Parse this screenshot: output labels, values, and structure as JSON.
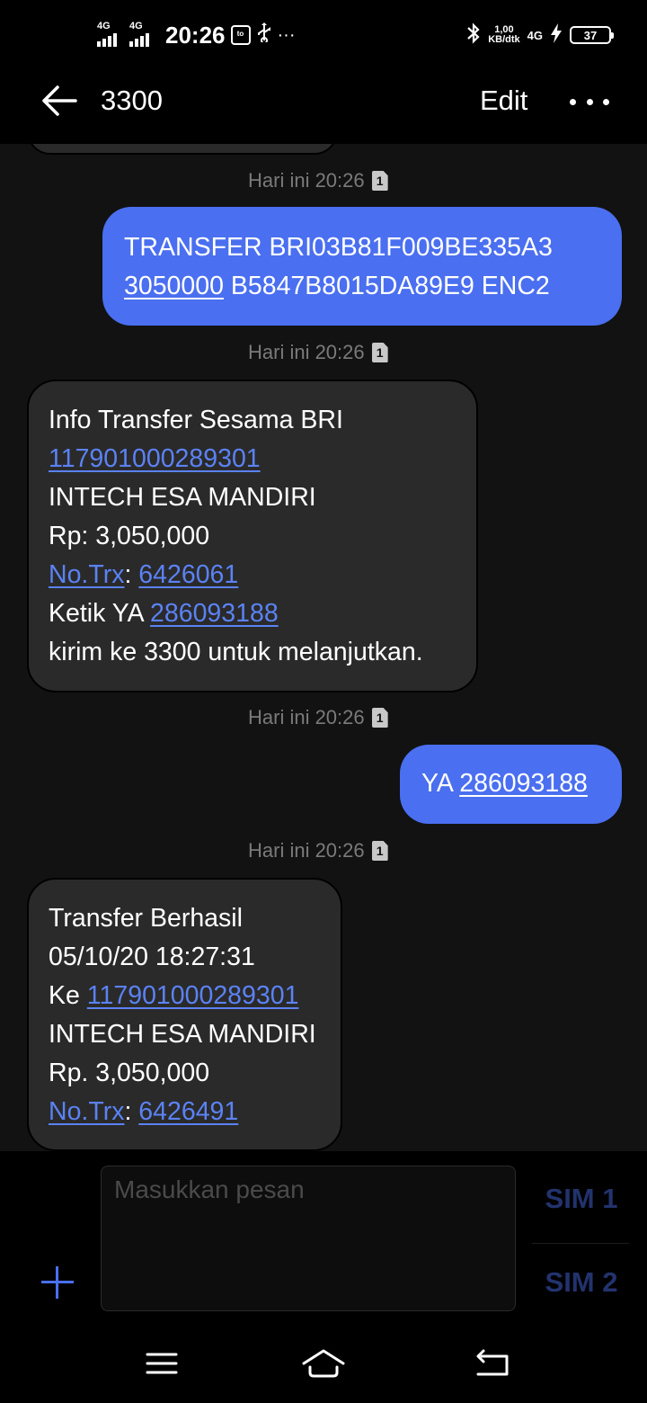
{
  "status_bar": {
    "network_1": "4G",
    "network_2": "4G",
    "time": "20:26",
    "app_badge": "ᵗᵒ",
    "more": "···",
    "speed_value": "1,00",
    "speed_unit": "KB/dtk",
    "network_type": "4G",
    "battery_level": "37"
  },
  "header": {
    "title": "3300",
    "edit_label": "Edit"
  },
  "messages": [
    {
      "timestamp": "Hari ini 20:26",
      "sim_badge": "1",
      "direction": "outgoing",
      "line1": "TRANSFER BRI03B81F009BE335A3",
      "line2_link": "3050000",
      "line2_rest": " B5847B8015DA89E9 ENC2"
    },
    {
      "timestamp": "Hari ini 20:26",
      "sim_badge": "1",
      "direction": "incoming",
      "line1": "Info Transfer Sesama BRI",
      "account_link": "117901000289301",
      "line3": "INTECH ESA MANDIRI",
      "line4": "Rp: 3,050,000",
      "trx_label_link": "No.Trx",
      "trx_colon": ": ",
      "trx_value_link": "6426061",
      "ketik_prefix": "Ketik YA ",
      "code_link": "286093188",
      "line7": "kirim ke 3300 untuk melanjutkan."
    },
    {
      "timestamp": "Hari ini 20:26",
      "sim_badge": "1",
      "direction": "outgoing",
      "prefix": "YA ",
      "code_link": "286093188"
    },
    {
      "timestamp": "Hari ini 20:26",
      "sim_badge": "1",
      "direction": "incoming",
      "line1": "Transfer Berhasil",
      "line2": "05/10/20 18:27:31",
      "ke_prefix": "Ke ",
      "account_link": "117901000289301",
      "line4": "INTECH ESA MANDIRI",
      "line5": "Rp. 3,050,000",
      "trx_label_link": "No.Trx",
      "trx_colon": ": ",
      "trx_value_link": "6426491"
    }
  ],
  "composer": {
    "placeholder": "Masukkan pesan",
    "sim1_label": "SIM 1",
    "sim2_label": "SIM 2"
  },
  "colors": {
    "accent": "#4a6ff0",
    "link": "#5b82f5",
    "incoming_bubble": "#2a2a2a",
    "background": "#121212"
  },
  "icons": {
    "back": "arrow-left-icon",
    "more": "more-dots-icon",
    "add": "plus-icon",
    "nav_menu": "menu-lines-icon",
    "nav_home": "home-icon",
    "nav_back": "return-icon"
  }
}
